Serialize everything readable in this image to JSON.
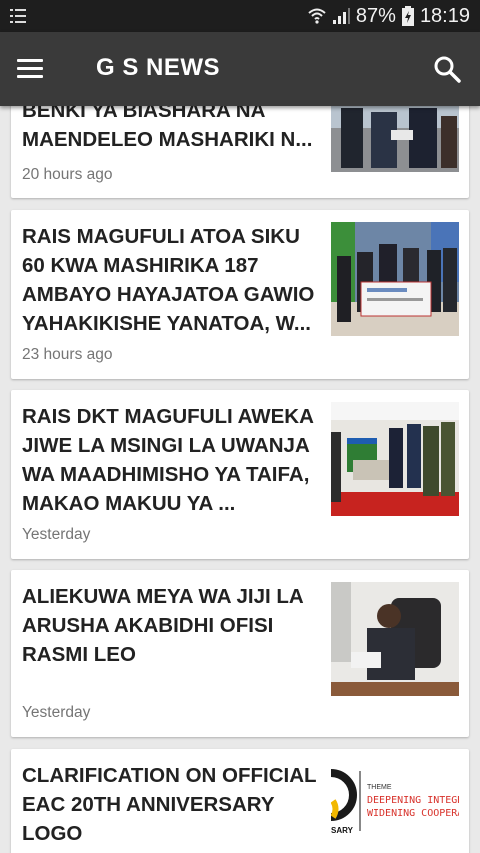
{
  "status_bar": {
    "battery": "87%",
    "time": "18:19",
    "icons": [
      "notification-list-icon",
      "wifi-icon",
      "signal-icon",
      "battery-icon"
    ]
  },
  "app_bar": {
    "title": "G S NEWS",
    "icons": [
      "menu-icon",
      "search-icon"
    ]
  },
  "articles": [
    {
      "title": "BENKI YA BIASHARA NA MAENDELEO MASHARIKI N...",
      "time": "20 hours ago"
    },
    {
      "title": "RAIS MAGUFULI ATOA SIKU 60 KWA MASHIRIKA 187 AMBAYO HAYAJATOA GAWIO YAHAKIKISHE YANATOA, W...",
      "time": "23 hours ago"
    },
    {
      "title": "RAIS DKT MAGUFULI AWEKA JIWE LA MSINGI LA UWANJA WA MAADHIMISHO YA TAIFA, MAKAO MAKUU YA ...",
      "time": "Yesterday"
    },
    {
      "title": "ALIEKUWA MEYA WA JIJI LA ARUSHA AKABIDHI OFISI RASMI LEO",
      "time": "Yesterday"
    },
    {
      "title": "CLARIFICATION ON OFFICIAL EAC 20TH ANNIVERSARY LOGO",
      "time": "",
      "thumb_text": [
        "THEME",
        "DEEPENING INTEGRA",
        "WIDENING COOPERA",
        "SARY"
      ]
    }
  ]
}
